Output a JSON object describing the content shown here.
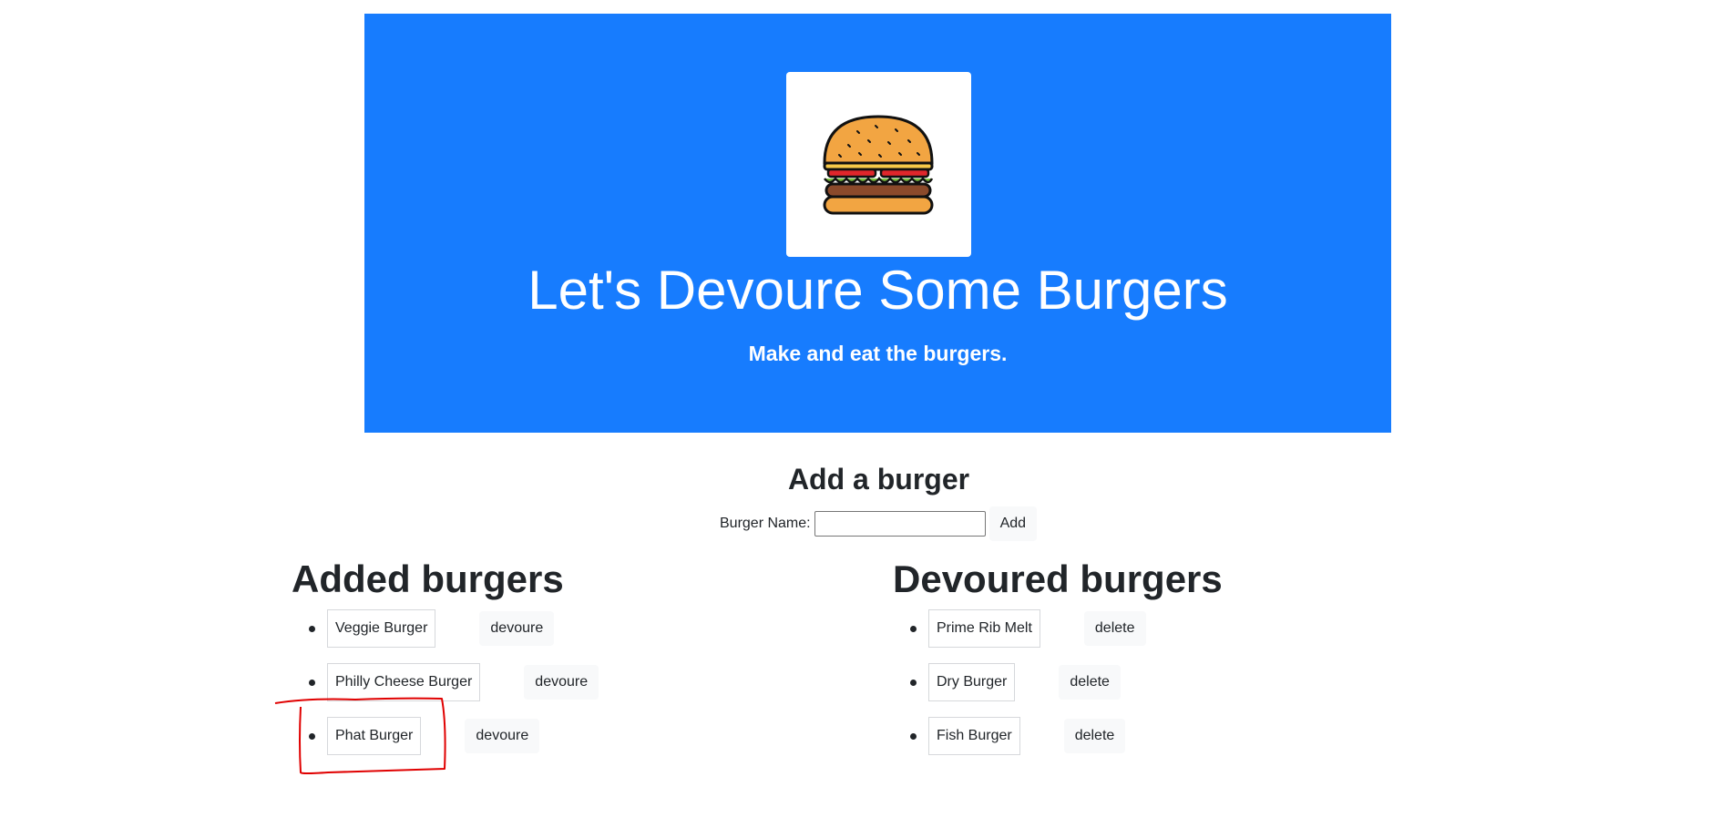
{
  "hero": {
    "logo_icon": "hamburger-icon",
    "title": "Let's Devoure Some Burgers",
    "subtitle": "Make and eat the burgers."
  },
  "add_form": {
    "heading": "Add a burger",
    "label": "Burger Name:",
    "input_value": "",
    "button_label": "Add"
  },
  "added": {
    "title": "Added burgers",
    "items": [
      {
        "name": "Veggie Burger",
        "action": "devoure"
      },
      {
        "name": "Philly Cheese Burger",
        "action": "devoure"
      },
      {
        "name": "Phat Burger",
        "action": "devoure"
      }
    ]
  },
  "devoured": {
    "title": "Devoured burgers",
    "items": [
      {
        "name": "Prime Rib Melt",
        "action": "delete"
      },
      {
        "name": "Dry Burger",
        "action": "delete"
      },
      {
        "name": "Fish Burger",
        "action": "delete"
      }
    ]
  },
  "colors": {
    "hero_bg": "#177cfe",
    "annotation": "#e00000"
  }
}
